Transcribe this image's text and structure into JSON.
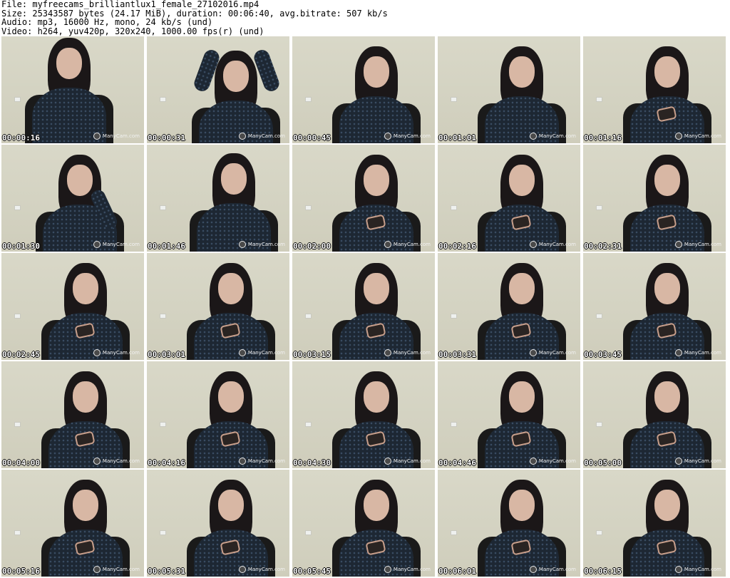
{
  "header": {
    "file_line": "File: myfreecams_brilliantlux1_female_27102016.mp4",
    "size_line": "Size: 25343587 bytes (24.17 MiB), duration: 00:06:40, avg.bitrate: 507 kb/s",
    "audio_line": "Audio: mp3, 16000 Hz, mono, 24 kb/s (und)",
    "video_line": "Video: h264, yuv420p, 320x240, 1000.00 fps(r) (und)"
  },
  "watermark": "ManyCam.com",
  "colors": {
    "background": "#ffffff",
    "wall": "#d6d5c4",
    "hair": "#1b1718",
    "sweater": "#1d2733",
    "timestamp_text": "#ffffff",
    "timestamp_outline": "#000000"
  },
  "thumbnails": [
    {
      "timestamp": "00:00:16",
      "pose": "facing-camera"
    },
    {
      "timestamp": "00:00:31",
      "pose": "hands-behind-head"
    },
    {
      "timestamp": "00:00:45",
      "pose": "facing-camera"
    },
    {
      "timestamp": "00:01:01",
      "pose": "facing-camera"
    },
    {
      "timestamp": "00:01:16",
      "pose": "looking-at-phone"
    },
    {
      "timestamp": "00:01:30",
      "pose": "hand-at-ear"
    },
    {
      "timestamp": "00:01:46",
      "pose": "looking-up"
    },
    {
      "timestamp": "00:02:00",
      "pose": "looking-at-phone"
    },
    {
      "timestamp": "00:02:16",
      "pose": "looking-at-phone"
    },
    {
      "timestamp": "00:02:31",
      "pose": "looking-at-phone"
    },
    {
      "timestamp": "00:02:45",
      "pose": "looking-at-phone"
    },
    {
      "timestamp": "00:03:01",
      "pose": "looking-at-phone"
    },
    {
      "timestamp": "00:03:15",
      "pose": "looking-at-phone"
    },
    {
      "timestamp": "00:03:31",
      "pose": "looking-at-phone"
    },
    {
      "timestamp": "00:03:45",
      "pose": "looking-at-phone"
    },
    {
      "timestamp": "00:04:00",
      "pose": "looking-at-phone"
    },
    {
      "timestamp": "00:04:16",
      "pose": "looking-at-phone"
    },
    {
      "timestamp": "00:04:30",
      "pose": "looking-at-phone"
    },
    {
      "timestamp": "00:04:46",
      "pose": "looking-at-phone"
    },
    {
      "timestamp": "00:05:00",
      "pose": "looking-at-phone"
    },
    {
      "timestamp": "00:05:16",
      "pose": "looking-at-phone"
    },
    {
      "timestamp": "00:05:31",
      "pose": "looking-at-phone"
    },
    {
      "timestamp": "00:05:45",
      "pose": "looking-at-phone"
    },
    {
      "timestamp": "00:06:01",
      "pose": "looking-at-phone"
    },
    {
      "timestamp": "00:06:15",
      "pose": "looking-at-phone"
    }
  ]
}
